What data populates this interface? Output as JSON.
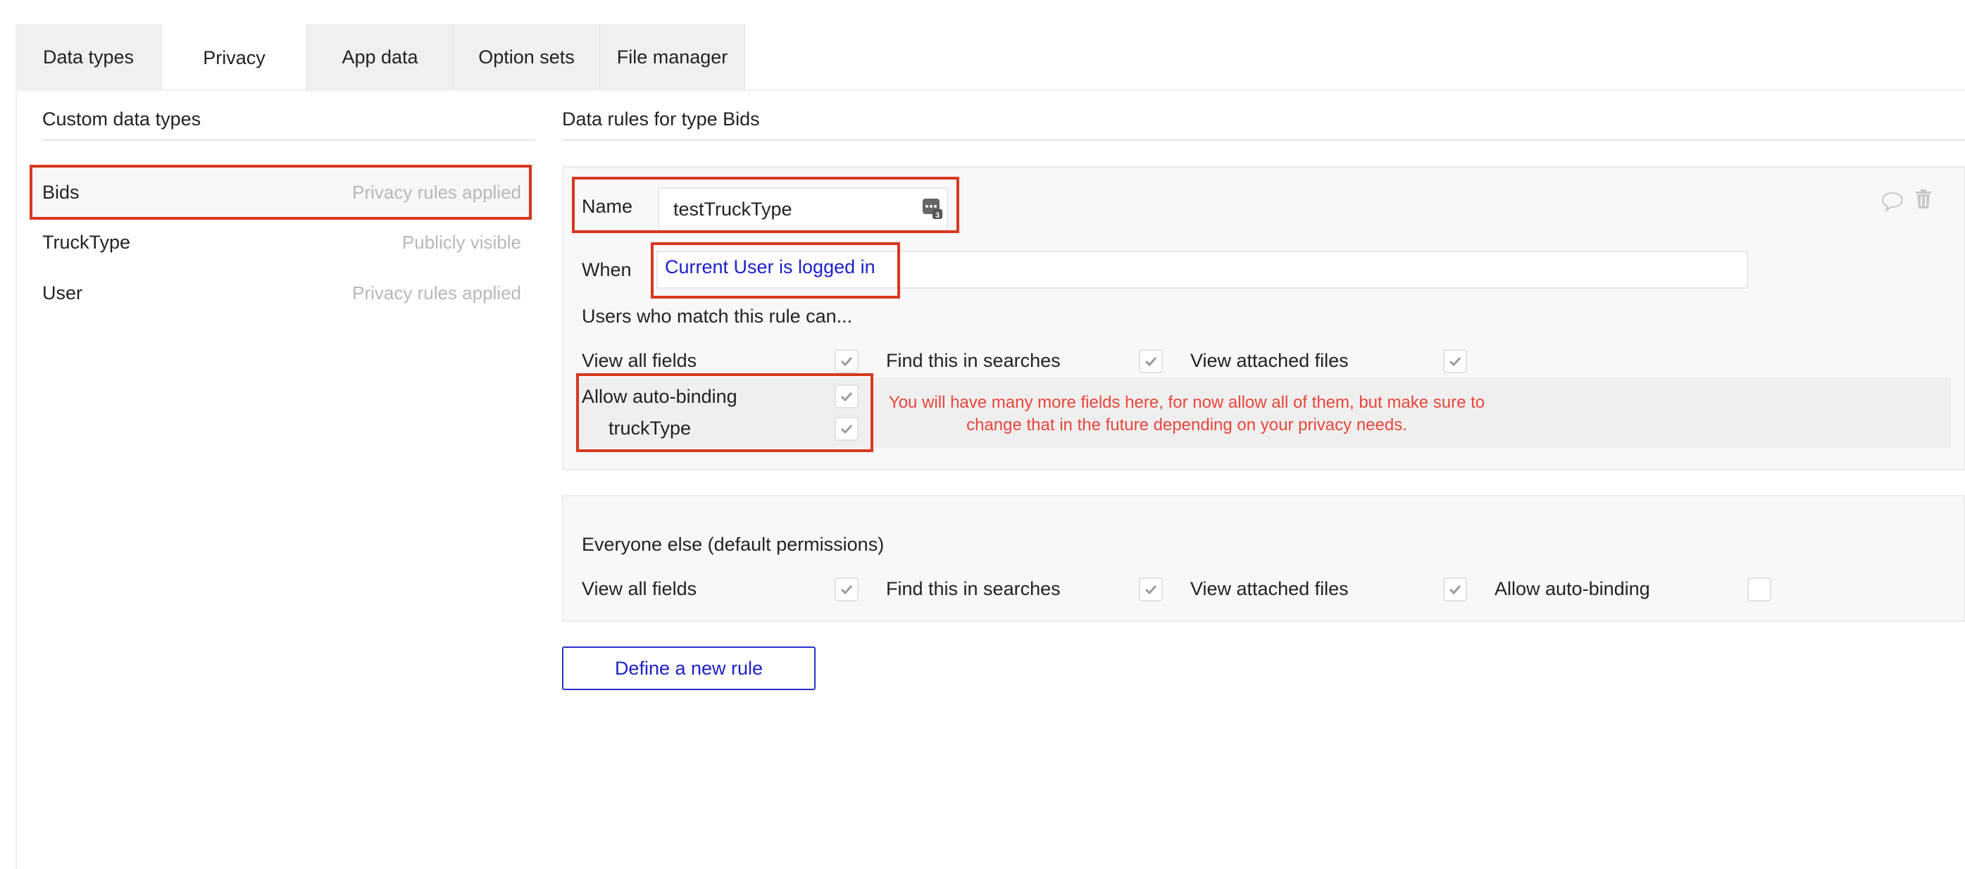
{
  "tabs": [
    {
      "label": "Data types"
    },
    {
      "label": "Privacy"
    },
    {
      "label": "App data"
    },
    {
      "label": "Option sets"
    },
    {
      "label": "File manager"
    }
  ],
  "active_tab": "Privacy",
  "left_panel": {
    "title": "Custom data types",
    "types": [
      {
        "name": "Bids",
        "status": "Privacy rules applied"
      },
      {
        "name": "TruckType",
        "status": "Publicly visible"
      },
      {
        "name": "User",
        "status": "Privacy rules applied"
      }
    ]
  },
  "right_panel": {
    "title": "Data rules for type Bids"
  },
  "rule": {
    "name_label": "Name",
    "name_value": "testTruckType",
    "expression_badge": "3",
    "when_label": "When",
    "when_value": "Current User is logged in",
    "users_match_label": "Users who match this rule can...",
    "permissions": {
      "view_all_fields": {
        "label": "View all fields",
        "checked": true
      },
      "find_in_searches": {
        "label": "Find this in searches",
        "checked": true
      },
      "view_attached_files": {
        "label": "View attached files",
        "checked": true
      },
      "allow_auto_binding": {
        "label": "Allow auto-binding",
        "checked": true
      },
      "truck_type": {
        "label": "truckType",
        "checked": true
      }
    },
    "note": "You will have many more fields here, for now allow all of them, but make sure to change that in the future depending on your privacy needs."
  },
  "everyone_else": {
    "title": "Everyone else (default permissions)",
    "permissions": {
      "view_all_fields": {
        "label": "View all fields",
        "checked": true
      },
      "find_in_searches": {
        "label": "Find this in searches",
        "checked": true
      },
      "view_attached_files": {
        "label": "View attached files",
        "checked": true
      },
      "allow_auto_binding": {
        "label": "Allow auto-binding",
        "checked": false
      }
    }
  },
  "define_rule_button": "Define a new rule",
  "colors": {
    "accent_blue": "#1d20c8",
    "annotation_red": "#d5391f",
    "note_red": "#e8463a",
    "checkmark_gray": "#9a9a9a"
  }
}
